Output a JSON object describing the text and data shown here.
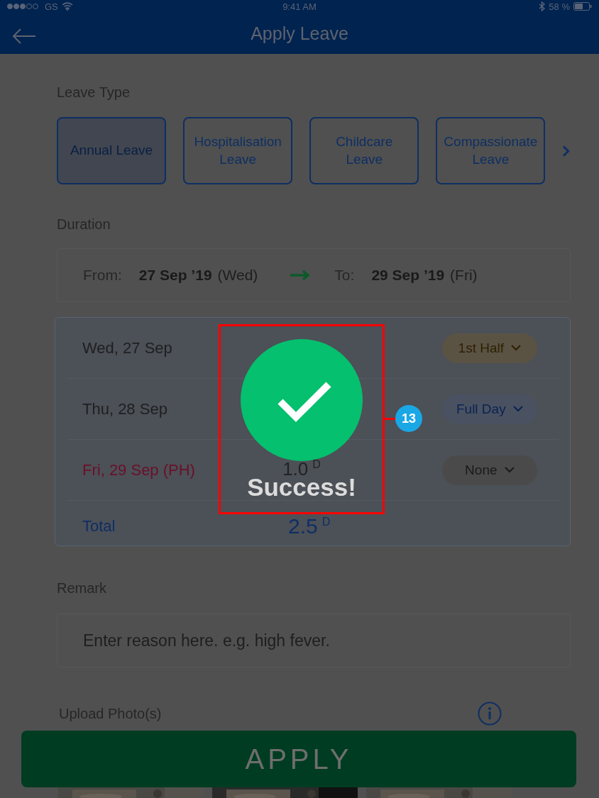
{
  "status_bar": {
    "carrier": "GS",
    "time": "9:41 AM",
    "battery": "58 %"
  },
  "header": {
    "title": "Apply Leave"
  },
  "leave_type": {
    "label": "Leave Type",
    "options": [
      {
        "lines": [
          "Annual Leave"
        ],
        "selected": true
      },
      {
        "lines": [
          "Hospitalisation",
          "Leave"
        ],
        "selected": false
      },
      {
        "lines": [
          "Childcare",
          "Leave"
        ],
        "selected": false
      },
      {
        "lines": [
          "Compassionate",
          "Leave"
        ],
        "selected": false
      }
    ]
  },
  "duration": {
    "label": "Duration",
    "from_label": "From:",
    "from_date": "27 Sep ’19",
    "from_day": "(Wed)",
    "to_label": "To:",
    "to_date": "29 Sep ’19",
    "to_day": "(Fri)"
  },
  "days": [
    {
      "date": "Wed, 27 Sep",
      "holiday": false,
      "option": "1st Half",
      "kind": "half"
    },
    {
      "date": "Thu, 28 Sep",
      "holiday": false,
      "option": "Full Day",
      "kind": "full"
    },
    {
      "date": "Fri, 29 Sep (PH)",
      "holiday": true,
      "value": "1.0",
      "unit": "D",
      "option": "None",
      "kind": "none"
    }
  ],
  "total": {
    "label": "Total",
    "value": "2.5",
    "unit": "D"
  },
  "remark": {
    "label": "Remark",
    "placeholder": "Enter reason here. e.g. high fever."
  },
  "upload": {
    "label": "Upload Photo(s)"
  },
  "apply_button": "APPLY",
  "dialog": {
    "message": "Success!"
  },
  "annotation": {
    "number": "13"
  }
}
